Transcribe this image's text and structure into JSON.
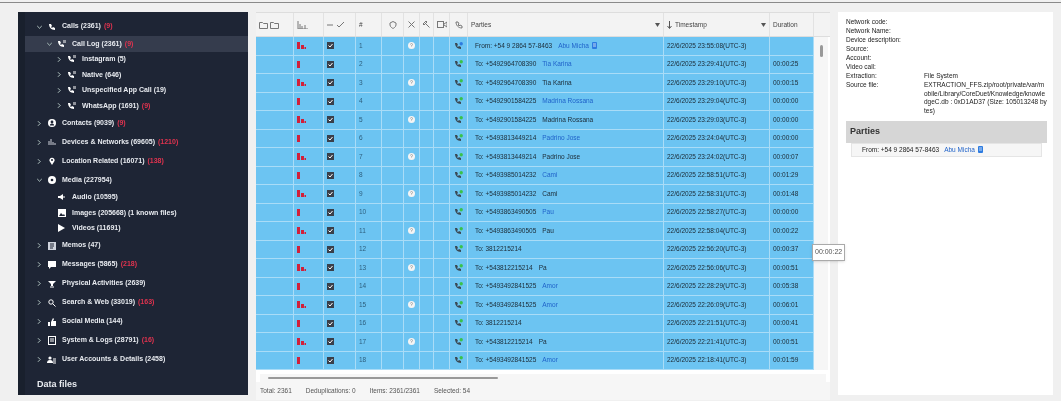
{
  "sidebar": {
    "items": [
      {
        "label": "Calls (2361)",
        "flag": "(9)",
        "kind": "group",
        "expanded": true,
        "selected": false,
        "children": [
          {
            "label": "Call Log (2361)",
            "flag": "(9)",
            "kind": "group",
            "expanded": true,
            "selected": true,
            "children": [
              {
                "label": "Instagram (5)",
                "kind": "group",
                "expanded": false,
                "selected": false
              },
              {
                "label": "Native (646)",
                "kind": "group",
                "expanded": false,
                "selected": false
              },
              {
                "label": "Unspecified App Call (19)",
                "kind": "group",
                "expanded": false,
                "selected": false
              },
              {
                "label": "WhatsApp (1691)",
                "flag": "(9)",
                "kind": "group",
                "expanded": false,
                "selected": false
              }
            ]
          }
        ]
      },
      {
        "label": "Contacts (9039)",
        "flag": "(9)",
        "kind": "group",
        "expanded": false,
        "selected": false
      },
      {
        "label": "Devices & Networks (69605)",
        "flag": "(1210)",
        "kind": "group",
        "expanded": false,
        "selected": false
      },
      {
        "label": "Location Related (16071)",
        "flag": "(138)",
        "kind": "group",
        "expanded": false,
        "selected": false
      },
      {
        "label": "Media (227954)",
        "kind": "group",
        "expanded": true,
        "selected": false,
        "children": [
          {
            "label": "Audio (10595)",
            "kind": "leaf",
            "selected": false
          },
          {
            "label": "Images (205668)  (1 known files)",
            "kind": "leaf",
            "selected": false
          },
          {
            "label": "Videos (11691)",
            "kind": "leaf",
            "selected": false
          }
        ]
      },
      {
        "label": "Memos (47)",
        "kind": "group",
        "expanded": false,
        "selected": false
      },
      {
        "label": "Messages (5865)",
        "flag": "(218)",
        "kind": "group",
        "expanded": false,
        "selected": false
      },
      {
        "label": "Physical Activities (2639)",
        "kind": "group",
        "expanded": false,
        "selected": false
      },
      {
        "label": "Search & Web (33019)",
        "flag": "(163)",
        "kind": "group",
        "expanded": false,
        "selected": false
      },
      {
        "label": "Social Media (144)",
        "kind": "group",
        "expanded": false,
        "selected": false
      },
      {
        "label": "System & Logs (28791)",
        "flag": "(16)",
        "kind": "group",
        "expanded": false,
        "selected": false
      },
      {
        "label": "User Accounts & Details (2458)",
        "kind": "group",
        "expanded": false,
        "selected": false
      }
    ],
    "section_title": "Data files"
  },
  "table": {
    "columns": [
      "#",
      "Parties",
      "Timestamp",
      "Duration"
    ],
    "rows": [
      {
        "number": "1",
        "double_bar": true,
        "checked": true,
        "info": true,
        "incoming": true,
        "prefix": "From:",
        "phone": "+54 9 2864 57-8463",
        "contact": "Abu Micha",
        "contact_linked": true,
        "contact_badge": true,
        "timestamp": "22/6/2025 23:55:08(UTC-3)",
        "selected": true
      },
      {
        "number": "2",
        "double_bar": false,
        "checked": true,
        "info": false,
        "incoming": false,
        "prefix": "To:",
        "phone": "+5492964708390",
        "contact": "Tia Karina",
        "contact_linked": true,
        "timestamp": "22/6/2025 23:29:41(UTC-3)",
        "duration": "00:00:25",
        "selected": true
      },
      {
        "number": "3",
        "double_bar": true,
        "checked": true,
        "info": true,
        "incoming": false,
        "prefix": "To:",
        "phone": "+5492964708390",
        "contact": "Tia Karina",
        "contact_linked": false,
        "timestamp": "22/6/2025 23:29:10(UTC-3)",
        "duration": "00:00:15",
        "selected": true
      },
      {
        "number": "4",
        "double_bar": false,
        "checked": true,
        "info": false,
        "incoming": false,
        "prefix": "To:",
        "phone": "+5492901584225",
        "contact": "Madrina Rossana",
        "contact_linked": true,
        "timestamp": "22/6/2025 23:29:04(UTC-3)",
        "duration": "00:00:00",
        "selected": true
      },
      {
        "number": "5",
        "double_bar": true,
        "checked": true,
        "info": true,
        "incoming": false,
        "prefix": "To:",
        "phone": "+5492901584225",
        "contact": "Madrina Rossana",
        "contact_linked": false,
        "timestamp": "22/6/2025 23:29:03(UTC-3)",
        "duration": "00:00:00",
        "selected": true
      },
      {
        "number": "6",
        "double_bar": false,
        "checked": true,
        "info": false,
        "incoming": false,
        "prefix": "To:",
        "phone": "+5493813449214",
        "contact": "Padrino Jose",
        "contact_linked": true,
        "timestamp": "22/6/2025 23:24:04(UTC-3)",
        "duration": "00:00:00",
        "selected": true
      },
      {
        "number": "7",
        "double_bar": true,
        "checked": true,
        "info": true,
        "incoming": false,
        "prefix": "To:",
        "phone": "+5493813449214",
        "contact": "Padrino Jose",
        "contact_linked": false,
        "timestamp": "22/6/2025 23:24:02(UTC-3)",
        "duration": "00:00:07",
        "selected": true
      },
      {
        "number": "8",
        "double_bar": false,
        "checked": true,
        "info": false,
        "incoming": false,
        "prefix": "To:",
        "phone": "+5493985014232",
        "contact": "Cami",
        "contact_linked": true,
        "timestamp": "22/6/2025 22:58:51(UTC-3)",
        "duration": "00:01:29",
        "selected": true
      },
      {
        "number": "9",
        "double_bar": true,
        "checked": true,
        "info": true,
        "incoming": false,
        "prefix": "To:",
        "phone": "+5493985014232",
        "contact": "Cami",
        "contact_linked": false,
        "timestamp": "22/6/2025 22:58:31(UTC-3)",
        "duration": "00:01:48",
        "selected": true
      },
      {
        "number": "10",
        "double_bar": false,
        "checked": true,
        "info": false,
        "incoming": false,
        "prefix": "To:",
        "phone": "+5493863490505",
        "contact": "Pau",
        "contact_linked": true,
        "timestamp": "22/6/2025 22:58:27(UTC-3)",
        "duration": "00:00:00",
        "selected": true
      },
      {
        "number": "11",
        "double_bar": true,
        "checked": true,
        "info": true,
        "incoming": false,
        "prefix": "To:",
        "phone": "+5493863490505",
        "contact": "Pau",
        "contact_linked": false,
        "timestamp": "22/6/2025 22:58:04(UTC-3)",
        "duration": "00:00:22",
        "selected": true
      },
      {
        "number": "12",
        "double_bar": false,
        "checked": true,
        "info": false,
        "incoming": false,
        "prefix": "To:",
        "phone": "3812215214",
        "timestamp": "22/6/2025 22:56:20(UTC-3)",
        "duration": "00:00:37",
        "selected": true
      },
      {
        "number": "13",
        "double_bar": true,
        "checked": true,
        "info": true,
        "incoming": false,
        "prefix": "To:",
        "phone": "+543812215214",
        "contact": "Pa",
        "contact_linked": false,
        "timestamp": "22/6/2025 22:56:06(UTC-3)",
        "duration": "00:00:51",
        "selected": true
      },
      {
        "number": "14",
        "double_bar": false,
        "checked": true,
        "info": false,
        "incoming": false,
        "prefix": "To:",
        "phone": "+5493492841525",
        "contact": "Amor",
        "contact_linked": true,
        "timestamp": "22/6/2025 22:28:29(UTC-3)",
        "duration": "00:05:38",
        "selected": true
      },
      {
        "number": "15",
        "double_bar": true,
        "checked": true,
        "info": true,
        "incoming": false,
        "prefix": "To:",
        "phone": "+5493492841525",
        "contact": "Amor",
        "contact_linked": true,
        "timestamp": "22/6/2025 22:26:09(UTC-3)",
        "duration": "00:06:01",
        "selected": true
      },
      {
        "number": "16",
        "double_bar": false,
        "checked": true,
        "info": false,
        "incoming": false,
        "prefix": "To:",
        "phone": "3812215214",
        "timestamp": "22/6/2025 22:21:51(UTC-3)",
        "duration": "00:00:41",
        "selected": true
      },
      {
        "number": "17",
        "double_bar": true,
        "checked": true,
        "info": true,
        "incoming": false,
        "prefix": "To:",
        "phone": "+543812215214",
        "contact": "Pa",
        "contact_linked": false,
        "timestamp": "22/6/2025 22:21:41(UTC-3)",
        "duration": "00:00:51",
        "selected": true
      },
      {
        "number": "18",
        "double_bar": false,
        "checked": true,
        "info": false,
        "incoming": false,
        "prefix": "To:",
        "phone": "+5493492841525",
        "contact": "Amor",
        "contact_linked": true,
        "timestamp": "22/6/2025 22:18:41(UTC-3)",
        "duration": "00:01:59",
        "selected": true
      }
    ],
    "tooltip": "00:00:22"
  },
  "status_bar": [
    "Total: 2361",
    "Deduplications: 0",
    "Items: 2361/2361",
    "Selected: 54"
  ],
  "details": {
    "fields": [
      {
        "label": "Network code:"
      },
      {
        "label": "Network Name:"
      },
      {
        "label": "Device description:"
      },
      {
        "label": "Source:"
      },
      {
        "label": "Account:"
      },
      {
        "label": "Video call:"
      },
      {
        "label": "Extraction:",
        "value": "File System"
      },
      {
        "label": "Source file:",
        "value": "EXTRACTION_FFS.zip/root/private/var/mobile/Library/CoreDuet/Knowledge/knowledgeC.db : 0xD1AD37 (Size: 105013248 bytes)"
      }
    ],
    "parties_title": "Parties",
    "party": {
      "prefix": "From:",
      "phone": "+54 9 2864 57-8463",
      "contact": "Abu Micha"
    }
  }
}
